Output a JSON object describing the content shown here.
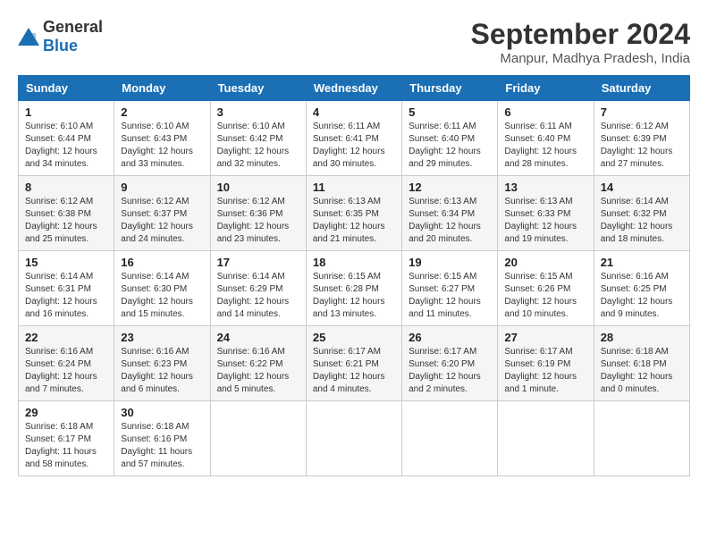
{
  "logo": {
    "general": "General",
    "blue": "Blue"
  },
  "title": {
    "month_year": "September 2024",
    "location": "Manpur, Madhya Pradesh, India"
  },
  "days_of_week": [
    "Sunday",
    "Monday",
    "Tuesday",
    "Wednesday",
    "Thursday",
    "Friday",
    "Saturday"
  ],
  "weeks": [
    [
      {
        "day": "1",
        "sunrise": "6:10 AM",
        "sunset": "6:44 PM",
        "daylight": "12 hours and 34 minutes."
      },
      {
        "day": "2",
        "sunrise": "6:10 AM",
        "sunset": "6:43 PM",
        "daylight": "12 hours and 33 minutes."
      },
      {
        "day": "3",
        "sunrise": "6:10 AM",
        "sunset": "6:42 PM",
        "daylight": "12 hours and 32 minutes."
      },
      {
        "day": "4",
        "sunrise": "6:11 AM",
        "sunset": "6:41 PM",
        "daylight": "12 hours and 30 minutes."
      },
      {
        "day": "5",
        "sunrise": "6:11 AM",
        "sunset": "6:40 PM",
        "daylight": "12 hours and 29 minutes."
      },
      {
        "day": "6",
        "sunrise": "6:11 AM",
        "sunset": "6:40 PM",
        "daylight": "12 hours and 28 minutes."
      },
      {
        "day": "7",
        "sunrise": "6:12 AM",
        "sunset": "6:39 PM",
        "daylight": "12 hours and 27 minutes."
      }
    ],
    [
      {
        "day": "8",
        "sunrise": "6:12 AM",
        "sunset": "6:38 PM",
        "daylight": "12 hours and 25 minutes."
      },
      {
        "day": "9",
        "sunrise": "6:12 AM",
        "sunset": "6:37 PM",
        "daylight": "12 hours and 24 minutes."
      },
      {
        "day": "10",
        "sunrise": "6:12 AM",
        "sunset": "6:36 PM",
        "daylight": "12 hours and 23 minutes."
      },
      {
        "day": "11",
        "sunrise": "6:13 AM",
        "sunset": "6:35 PM",
        "daylight": "12 hours and 21 minutes."
      },
      {
        "day": "12",
        "sunrise": "6:13 AM",
        "sunset": "6:34 PM",
        "daylight": "12 hours and 20 minutes."
      },
      {
        "day": "13",
        "sunrise": "6:13 AM",
        "sunset": "6:33 PM",
        "daylight": "12 hours and 19 minutes."
      },
      {
        "day": "14",
        "sunrise": "6:14 AM",
        "sunset": "6:32 PM",
        "daylight": "12 hours and 18 minutes."
      }
    ],
    [
      {
        "day": "15",
        "sunrise": "6:14 AM",
        "sunset": "6:31 PM",
        "daylight": "12 hours and 16 minutes."
      },
      {
        "day": "16",
        "sunrise": "6:14 AM",
        "sunset": "6:30 PM",
        "daylight": "12 hours and 15 minutes."
      },
      {
        "day": "17",
        "sunrise": "6:14 AM",
        "sunset": "6:29 PM",
        "daylight": "12 hours and 14 minutes."
      },
      {
        "day": "18",
        "sunrise": "6:15 AM",
        "sunset": "6:28 PM",
        "daylight": "12 hours and 13 minutes."
      },
      {
        "day": "19",
        "sunrise": "6:15 AM",
        "sunset": "6:27 PM",
        "daylight": "12 hours and 11 minutes."
      },
      {
        "day": "20",
        "sunrise": "6:15 AM",
        "sunset": "6:26 PM",
        "daylight": "12 hours and 10 minutes."
      },
      {
        "day": "21",
        "sunrise": "6:16 AM",
        "sunset": "6:25 PM",
        "daylight": "12 hours and 9 minutes."
      }
    ],
    [
      {
        "day": "22",
        "sunrise": "6:16 AM",
        "sunset": "6:24 PM",
        "daylight": "12 hours and 7 minutes."
      },
      {
        "day": "23",
        "sunrise": "6:16 AM",
        "sunset": "6:23 PM",
        "daylight": "12 hours and 6 minutes."
      },
      {
        "day": "24",
        "sunrise": "6:16 AM",
        "sunset": "6:22 PM",
        "daylight": "12 hours and 5 minutes."
      },
      {
        "day": "25",
        "sunrise": "6:17 AM",
        "sunset": "6:21 PM",
        "daylight": "12 hours and 4 minutes."
      },
      {
        "day": "26",
        "sunrise": "6:17 AM",
        "sunset": "6:20 PM",
        "daylight": "12 hours and 2 minutes."
      },
      {
        "day": "27",
        "sunrise": "6:17 AM",
        "sunset": "6:19 PM",
        "daylight": "12 hours and 1 minute."
      },
      {
        "day": "28",
        "sunrise": "6:18 AM",
        "sunset": "6:18 PM",
        "daylight": "12 hours and 0 minutes."
      }
    ],
    [
      {
        "day": "29",
        "sunrise": "6:18 AM",
        "sunset": "6:17 PM",
        "daylight": "11 hours and 58 minutes."
      },
      {
        "day": "30",
        "sunrise": "6:18 AM",
        "sunset": "6:16 PM",
        "daylight": "11 hours and 57 minutes."
      },
      null,
      null,
      null,
      null,
      null
    ]
  ]
}
